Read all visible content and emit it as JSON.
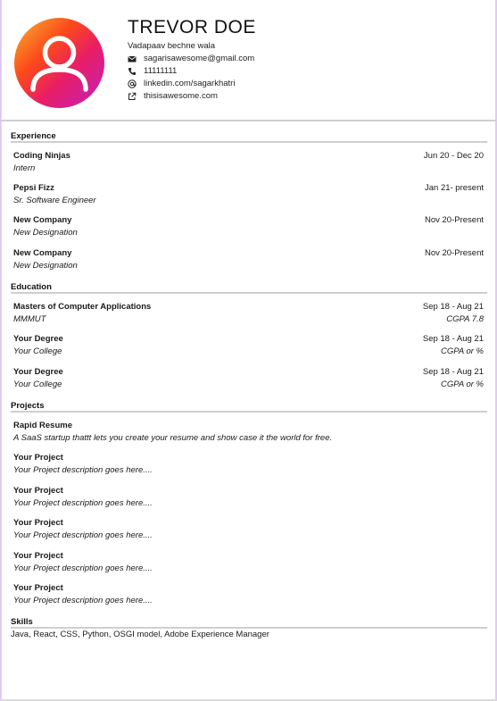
{
  "header": {
    "name": "TREVOR DOE",
    "tagline": "Vadapaav bechne wala",
    "contacts": [
      {
        "icon": "envelope-icon",
        "text": "sagarisawesome@gmail.com"
      },
      {
        "icon": "phone-icon",
        "text": "11111111"
      },
      {
        "icon": "at-icon",
        "text": "linkedin.com/sagarkhatri"
      },
      {
        "icon": "external-link-icon",
        "text": "thisisawesome.com"
      }
    ]
  },
  "experience": {
    "title": "Experience",
    "items": [
      {
        "company": "Coding Ninjas",
        "role": "Intern",
        "dates": "Jun 20 - Dec 20"
      },
      {
        "company": "Pepsi Fizz",
        "role": "Sr. Software Engineer",
        "dates": "Jan 21- present"
      },
      {
        "company": "New Company",
        "role": "New Designation",
        "dates": "Nov 20-Present"
      },
      {
        "company": "New Company",
        "role": "New Designation",
        "dates": "Nov 20-Present"
      }
    ]
  },
  "education": {
    "title": "Education",
    "items": [
      {
        "degree": "Masters of Computer Applications",
        "school": "MMMUT",
        "dates": "Sep 18 - Aug 21",
        "grade": "CGPA 7.8"
      },
      {
        "degree": "Your Degree",
        "school": "Your College",
        "dates": "Sep 18 - Aug 21",
        "grade": "CGPA or %"
      },
      {
        "degree": "Your Degree",
        "school": "Your College",
        "dates": "Sep 18 - Aug 21",
        "grade": "CGPA or %"
      }
    ]
  },
  "projects": {
    "title": "Projects",
    "items": [
      {
        "name": "Rapid Resume",
        "desc": "A SaaS startup thattt lets you create your resume and show case it the world for free."
      },
      {
        "name": "Your Project",
        "desc": "Your Project description goes here...."
      },
      {
        "name": "Your Project",
        "desc": "Your Project description goes here...."
      },
      {
        "name": "Your Project",
        "desc": "Your Project description goes here...."
      },
      {
        "name": "Your Project",
        "desc": "Your Project description goes here...."
      },
      {
        "name": "Your Project",
        "desc": "Your Project description goes here...."
      }
    ]
  },
  "skills": {
    "title": "Skills",
    "text": "Java, React, CSS, Python, OSGI model, Adobe Experience Manager"
  }
}
